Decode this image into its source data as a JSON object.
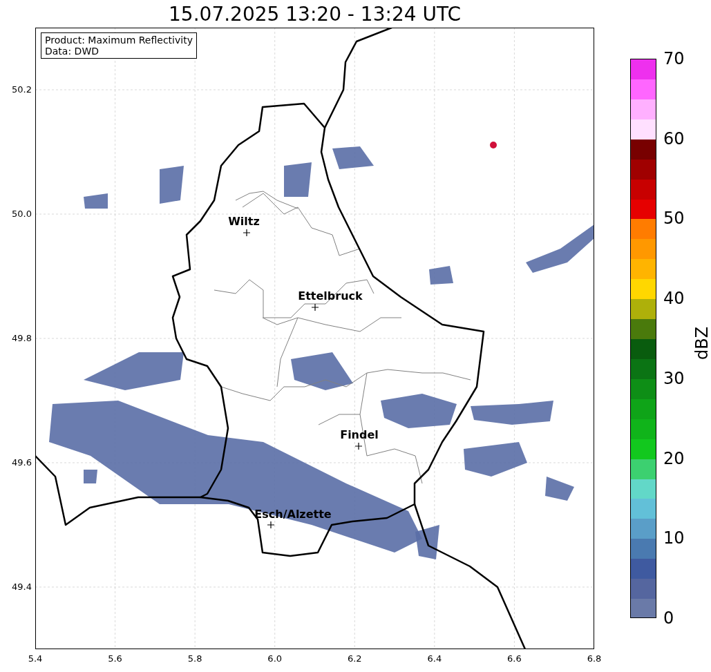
{
  "title": "15.07.2025 13:20 - 13:24 UTC",
  "info_box": [
    "Product: Maximum Reflectivity",
    "Data: DWD"
  ],
  "cities": [
    {
      "name": "Wiltz"
    },
    {
      "name": "Ettelbruck"
    },
    {
      "name": "Findel"
    },
    {
      "name": "Esch/Alzette"
    }
  ],
  "x_ticks": [
    "5.4",
    "5.6",
    "5.8",
    "6.0",
    "6.2",
    "6.4",
    "6.6",
    "6.8"
  ],
  "y_ticks": [
    "50.2",
    "50.0",
    "49.8",
    "49.6",
    "49.4"
  ],
  "colorbar": {
    "label": "dBZ",
    "ticks": [
      "70",
      "60",
      "50",
      "40",
      "30",
      "20",
      "10",
      "0"
    ],
    "bins": [
      {
        "color": "#ee30ee"
      },
      {
        "color": "#ff66ff"
      },
      {
        "color": "#ffb0ff"
      },
      {
        "color": "#ffe0ff"
      },
      {
        "color": "#780000"
      },
      {
        "color": "#a00000"
      },
      {
        "color": "#c80000"
      },
      {
        "color": "#e60000"
      },
      {
        "color": "#ff7c00"
      },
      {
        "color": "#ff9800"
      },
      {
        "color": "#ffb400"
      },
      {
        "color": "#ffd700"
      },
      {
        "color": "#aeb00a"
      },
      {
        "color": "#4a7a0c"
      },
      {
        "color": "#095c0e"
      },
      {
        "color": "#0b7414"
      },
      {
        "color": "#0e8e16"
      },
      {
        "color": "#0fa418"
      },
      {
        "color": "#10b41a"
      },
      {
        "color": "#12c81e"
      },
      {
        "color": "#3cd070"
      },
      {
        "color": "#62d8c8"
      },
      {
        "color": "#62c0d8"
      },
      {
        "color": "#5a9ec8"
      },
      {
        "color": "#4a7ab0"
      },
      {
        "color": "#3f5aa0"
      },
      {
        "color": "#55669f"
      },
      {
        "color": "#6a7aa8"
      }
    ]
  }
}
